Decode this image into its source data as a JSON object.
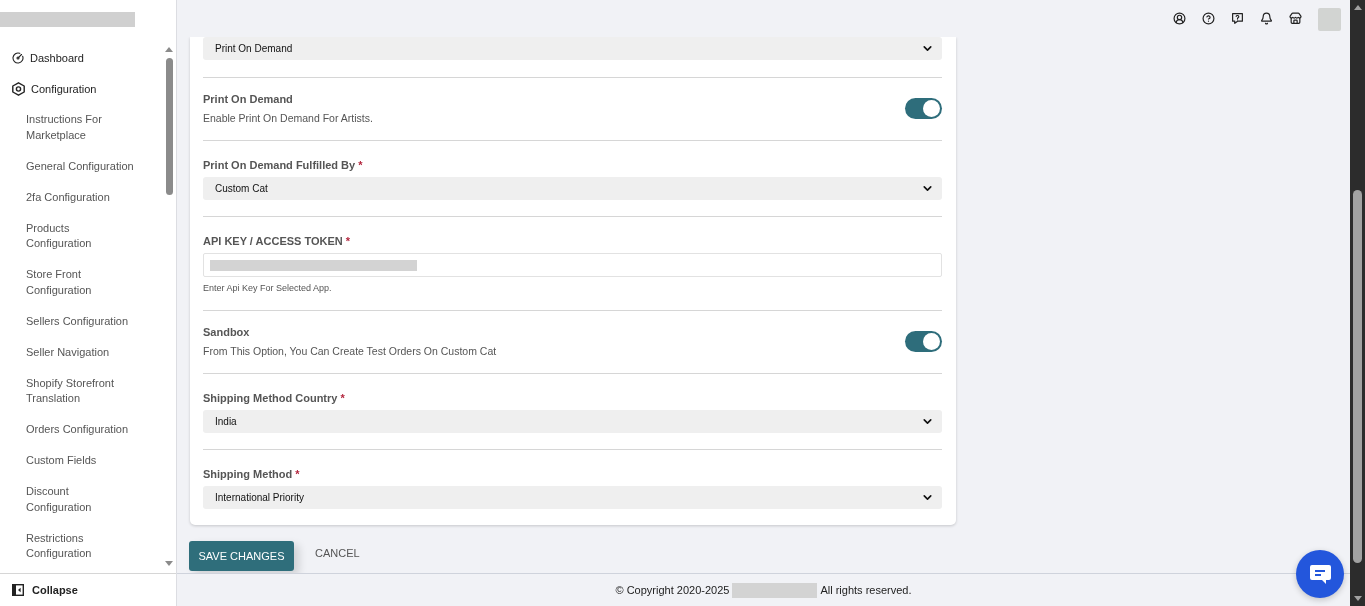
{
  "sidebar": {
    "menu": [
      {
        "label": "Dashboard"
      },
      {
        "label": "Configuration",
        "children": [
          {
            "label": "Instructions For Marketplace"
          },
          {
            "label": "General Configuration"
          },
          {
            "label": "2fa Configuration"
          },
          {
            "label": "Products Configuration"
          },
          {
            "label": "Store Front Configuration"
          },
          {
            "label": "Sellers Configuration"
          },
          {
            "label": "Seller Navigation"
          },
          {
            "label": "Shopify Storefront Translation"
          },
          {
            "label": "Orders Configuration"
          },
          {
            "label": "Custom Fields"
          },
          {
            "label": "Discount Configuration"
          },
          {
            "label": "Restrictions Configuration"
          }
        ]
      }
    ],
    "collapse": "Collapse"
  },
  "form": {
    "sections": [
      {
        "kind": "select",
        "value": "Print On Demand"
      },
      {
        "kind": "toggle",
        "title": "Print On Demand",
        "description": "Enable Print On Demand For Artists.",
        "on": true
      },
      {
        "kind": "select",
        "label": "Print On Demand Fulfilled By",
        "required_mark": "*",
        "value": "Custom Cat"
      },
      {
        "kind": "input",
        "label": "API KEY / ACCESS TOKEN",
        "required_mark": "*",
        "hint": "Enter Api Key For Selected App."
      },
      {
        "kind": "toggle",
        "title": "Sandbox",
        "description": "From This Option, You Can Create Test Orders On Custom Cat",
        "on": true
      },
      {
        "kind": "select",
        "label": "Shipping Method Country",
        "required_mark": "*",
        "value": "India"
      },
      {
        "kind": "select",
        "label": "Shipping Method",
        "required_mark": "*",
        "value": "International Priority"
      }
    ]
  },
  "actions": [
    {
      "kind": "primary",
      "label": "SAVE CHANGES"
    },
    {
      "kind": "text",
      "label": "CANCEL"
    }
  ],
  "footer": {
    "copyright": "© Copyright 2020-2025",
    "rights": "All rights reserved."
  }
}
